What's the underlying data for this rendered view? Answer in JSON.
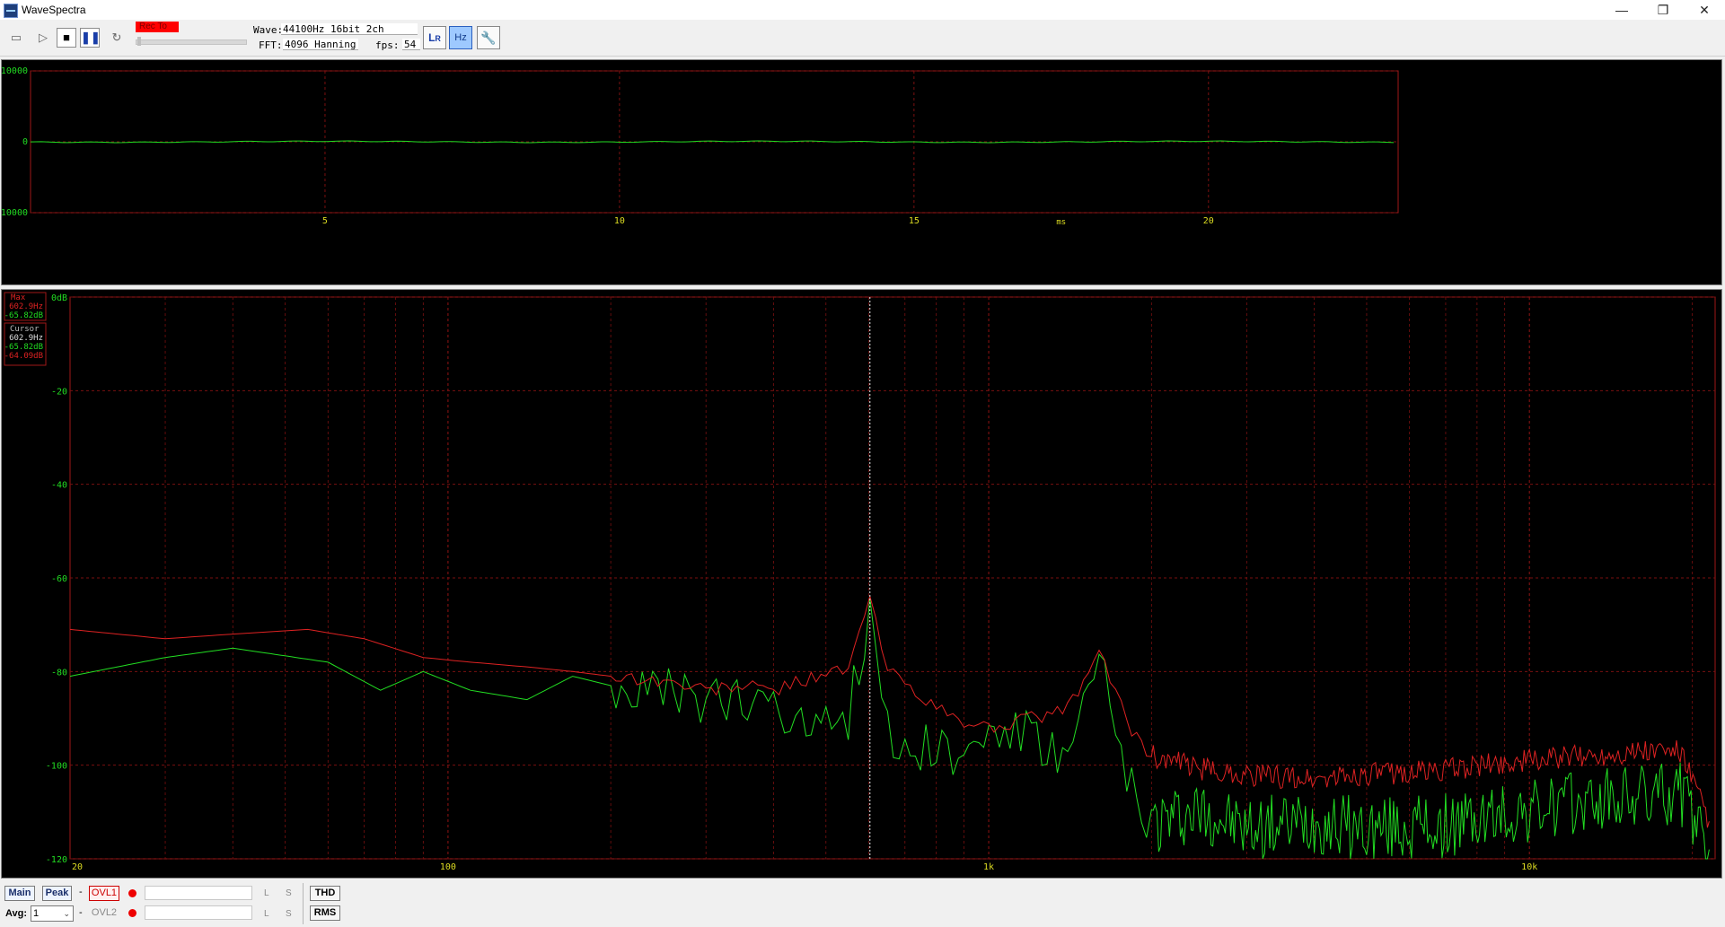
{
  "window": {
    "title": "WaveSpectra"
  },
  "toolbar": {
    "rec_label": "Rec To",
    "wave_label": "Wave:",
    "wave_value": "44100Hz 16bit 2ch",
    "fft_label": "FFT:",
    "fft_value": "4096 Hanning",
    "fps_label": "fps:",
    "fps_value": "54"
  },
  "wave": {
    "y_ticks": [
      "10000",
      "0",
      "-10000"
    ],
    "x_ticks": [
      "5",
      "10",
      "15",
      "20"
    ],
    "x_unit": "ms",
    "trace_color": "#22dd22"
  },
  "spectrum": {
    "y_ticks": [
      "0dB",
      "-20",
      "-40",
      "-60",
      "-80",
      "-100",
      "-120"
    ],
    "x_ticks": [
      "20",
      "100",
      "1k",
      "10k"
    ],
    "max_label": "Max",
    "max_freq": "602.9Hz",
    "max_db": "-65.82dB",
    "cursor_label": "Cursor",
    "cursor_freq": "602.9Hz",
    "cursor_db_l": "-65.82dB",
    "cursor_db_r": "-64.09dB",
    "color_l": "#22dd22",
    "color_r": "#dd2222",
    "grid_color": "#7a1010"
  },
  "chart_data": {
    "type": "line",
    "x_scale": "log",
    "xlim": [
      20,
      22050
    ],
    "ylim": [
      -120,
      0
    ],
    "series": [
      {
        "channel": "L",
        "color": "#22dd22",
        "x": [
          20,
          30,
          40,
          60,
          75,
          90,
          110,
          140,
          170,
          200,
          250,
          300,
          350,
          400,
          450,
          500,
          550,
          602.9,
          650,
          700,
          800,
          900,
          1000,
          1200,
          1400,
          1600,
          1800,
          2000,
          2500,
          3000,
          4000,
          5000,
          7000,
          10000,
          13000,
          16000,
          19000,
          21500
        ],
        "y": [
          -81,
          -77,
          -75,
          -78,
          -84,
          -80,
          -84,
          -86,
          -81,
          -83,
          -85,
          -86,
          -88,
          -84,
          -93,
          -86,
          -90,
          -66,
          -92,
          -98,
          -94,
          -100,
          -92,
          -94,
          -100,
          -78,
          -104,
          -112,
          -110,
          -114,
          -112,
          -114,
          -113,
          -110,
          -108,
          -107,
          -106,
          -118
        ]
      },
      {
        "channel": "R",
        "color": "#dd2222",
        "x": [
          20,
          30,
          40,
          55,
          70,
          90,
          110,
          140,
          170,
          200,
          250,
          300,
          350,
          400,
          450,
          500,
          550,
          602.9,
          650,
          700,
          800,
          900,
          1000,
          1200,
          1400,
          1600,
          1800,
          2000,
          2500,
          3000,
          4000,
          5000,
          7000,
          10000,
          13000,
          16000,
          19000,
          21500
        ],
        "y": [
          -71,
          -73,
          -72,
          -71,
          -73,
          -77,
          -78,
          -79,
          -80,
          -81,
          -82,
          -84,
          -83,
          -84,
          -82,
          -80,
          -80,
          -64,
          -80,
          -82,
          -88,
          -91,
          -92,
          -90,
          -88,
          -76,
          -90,
          -98,
          -101,
          -102,
          -103,
          -102,
          -101,
          -99,
          -98,
          -97,
          -97,
          -112
        ]
      }
    ]
  },
  "bottom": {
    "main_label": "Main",
    "peak_label": "Peak",
    "dash": "-",
    "ovl1_label": "OVL1",
    "ovl2_label": "OVL2",
    "avg_label": "Avg:",
    "avg_value": "1",
    "L": "L",
    "S": "S",
    "thd_label": "THD",
    "rms_label": "RMS"
  }
}
